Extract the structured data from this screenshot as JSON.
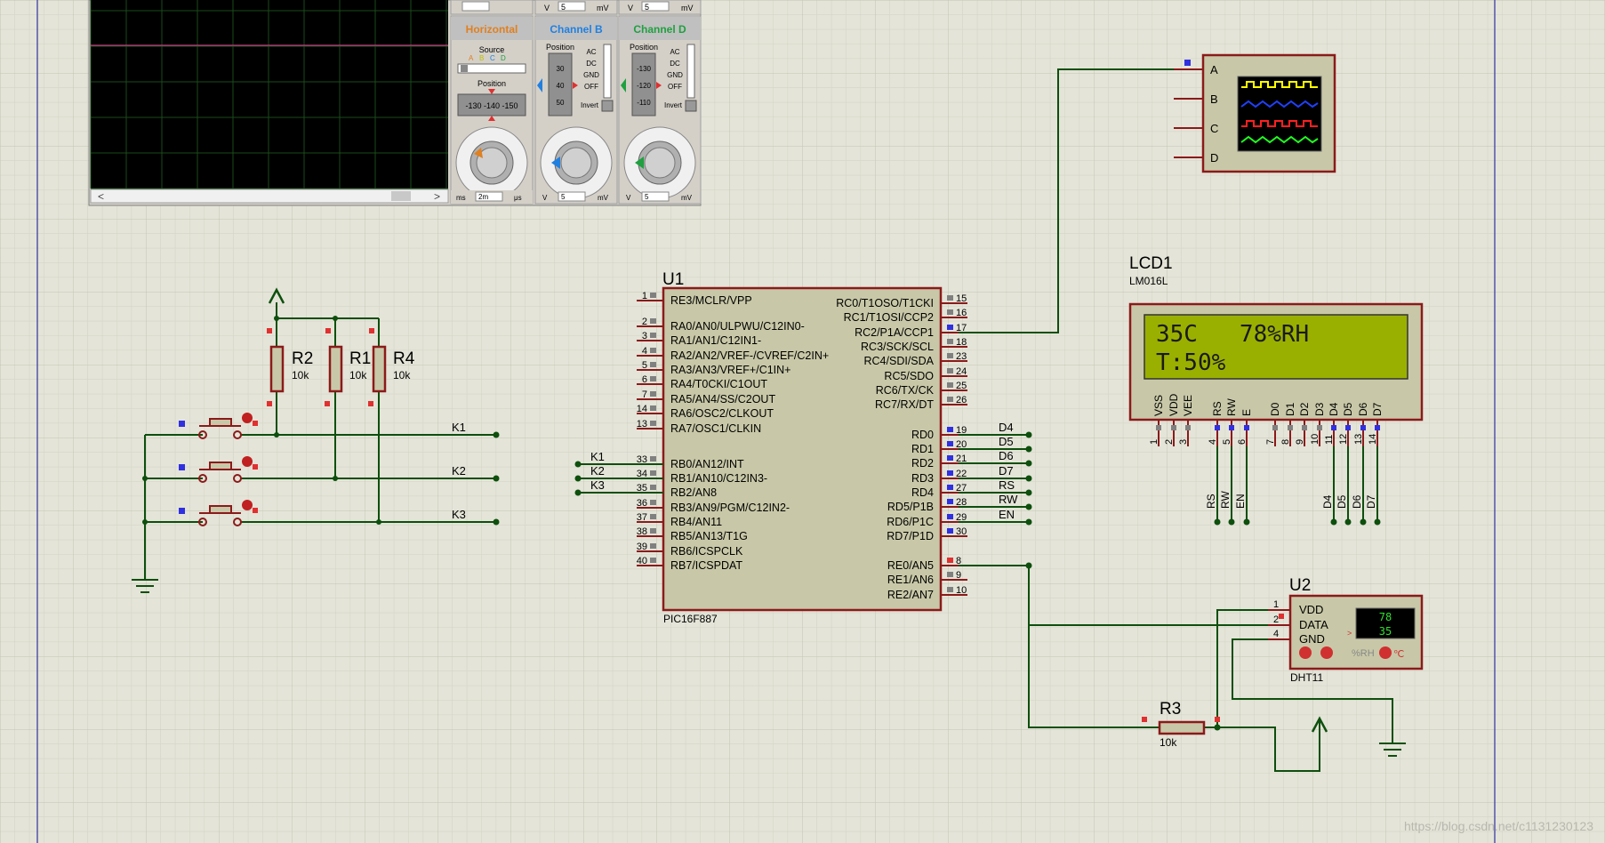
{
  "colors": {
    "background": "#e4e4d8",
    "grid_minor": "#d2d2c4",
    "grid_major": "#c4c4b4",
    "wire": "#0d4f0d",
    "component_outline": "#8b1a1a",
    "component_fill": "#c8c8a8",
    "pin_red": "#e03030",
    "pin_blue": "#3030e0",
    "lcd_screen": "#9ab000",
    "scope_screen": "#000000"
  },
  "mcu": {
    "ref": "U1",
    "part": "PIC16F887",
    "left_pins": [
      {
        "num": "1",
        "label": "RE3/MCLR/VPP"
      },
      {
        "num": "2",
        "label": "RA0/AN0/ULPWU/C12IN0-"
      },
      {
        "num": "3",
        "label": "RA1/AN1/C12IN1-"
      },
      {
        "num": "4",
        "label": "RA2/AN2/VREF-/CVREF/C2IN+"
      },
      {
        "num": "5",
        "label": "RA3/AN3/VREF+/C1IN+"
      },
      {
        "num": "6",
        "label": "RA4/T0CKI/C1OUT"
      },
      {
        "num": "7",
        "label": "RA5/AN4/SS/C2OUT"
      },
      {
        "num": "14",
        "label": "RA6/OSC2/CLKOUT"
      },
      {
        "num": "13",
        "label": "RA7/OSC1/CLKIN"
      },
      {
        "num": "33",
        "label": "RB0/AN12/INT"
      },
      {
        "num": "34",
        "label": "RB1/AN10/C12IN3-"
      },
      {
        "num": "35",
        "label": "RB2/AN8"
      },
      {
        "num": "36",
        "label": "RB3/AN9/PGM/C12IN2-"
      },
      {
        "num": "37",
        "label": "RB4/AN11"
      },
      {
        "num": "38",
        "label": "RB5/AN13/T1G"
      },
      {
        "num": "39",
        "label": "RB6/ICSPCLK"
      },
      {
        "num": "40",
        "label": "RB7/ICSPDAT"
      }
    ],
    "right_pins": [
      {
        "num": "15",
        "label": "RC0/T1OSO/T1CKI"
      },
      {
        "num": "16",
        "label": "RC1/T1OSI/CCP2"
      },
      {
        "num": "17",
        "label": "RC2/P1A/CCP1"
      },
      {
        "num": "18",
        "label": "RC3/SCK/SCL"
      },
      {
        "num": "23",
        "label": "RC4/SDI/SDA"
      },
      {
        "num": "24",
        "label": "RC5/SDO"
      },
      {
        "num": "25",
        "label": "RC6/TX/CK"
      },
      {
        "num": "26",
        "label": "RC7/RX/DT"
      },
      {
        "num": "19",
        "label": "RD0"
      },
      {
        "num": "20",
        "label": "RD1"
      },
      {
        "num": "21",
        "label": "RD2"
      },
      {
        "num": "22",
        "label": "RD3"
      },
      {
        "num": "27",
        "label": "RD4"
      },
      {
        "num": "28",
        "label": "RD5/P1B"
      },
      {
        "num": "29",
        "label": "RD6/P1C"
      },
      {
        "num": "30",
        "label": "RD7/P1D"
      },
      {
        "num": "8",
        "label": "RE0/AN5"
      },
      {
        "num": "9",
        "label": "RE1/AN6"
      },
      {
        "num": "10",
        "label": "RE2/AN7"
      }
    ],
    "net_labels_left": [
      "K1",
      "K2",
      "K3"
    ],
    "net_labels_right": [
      "D4",
      "D5",
      "D6",
      "D7",
      "RS",
      "RW",
      "EN"
    ]
  },
  "lcd": {
    "ref": "LCD1",
    "part": "LM016L",
    "line1": "35C   78%RH",
    "line2": "T:50%",
    "pin_names": [
      "VSS",
      "VDD",
      "VEE",
      "RS",
      "RW",
      "E",
      "D0",
      "D1",
      "D2",
      "D3",
      "D4",
      "D5",
      "D6",
      "D7"
    ],
    "pin_nums": [
      "1",
      "2",
      "3",
      "4",
      "5",
      "6",
      "7",
      "8",
      "9",
      "10",
      "11",
      "12",
      "13",
      "14"
    ],
    "net_labels": [
      "RS",
      "RW",
      "EN",
      "D4",
      "D5",
      "D6",
      "D7"
    ]
  },
  "sensor": {
    "ref": "U2",
    "part": "DHT11",
    "pins": [
      {
        "num": "1",
        "label": "VDD"
      },
      {
        "num": "2",
        "label": "DATA"
      },
      {
        "num": "4",
        "label": "GND"
      }
    ],
    "display_hum": "78",
    "display_temp": "35",
    "unit_label": "%RH",
    "symbol": "℃"
  },
  "scope": {
    "channels": [
      "A",
      "B",
      "C",
      "D"
    ],
    "panels": [
      {
        "title": "Horizontal",
        "color": "#e08020"
      },
      {
        "title": "Channel B",
        "color": "#2080e0"
      },
      {
        "title": "Channel D",
        "color": "#20a040"
      }
    ],
    "source_label": "Source",
    "position_label": "Position",
    "position_readout": "-130 -140 -150",
    "coupling": [
      "AC",
      "DC",
      "GND",
      "OFF"
    ],
    "invert_label": "Invert",
    "chb_scale": [
      "30",
      "40",
      "50"
    ],
    "chd_scale": [
      "-130",
      "-120",
      "-110"
    ],
    "top_units": [
      "V",
      "5",
      "mV",
      "V",
      "5",
      "mV"
    ],
    "bottom_horizontal": [
      "ms",
      "2m",
      "μs"
    ],
    "bottom_b": [
      "V",
      "5",
      "mV"
    ],
    "bottom_d": [
      "V",
      "5",
      "mV"
    ]
  },
  "resistors": [
    {
      "ref": "R2",
      "value": "10k"
    },
    {
      "ref": "R1",
      "value": "10k"
    },
    {
      "ref": "R4",
      "value": "10k"
    },
    {
      "ref": "R3",
      "value": "10k"
    }
  ],
  "switches": [
    {
      "net": "K1"
    },
    {
      "net": "K2"
    },
    {
      "net": "K3"
    }
  ],
  "watermark": "https://blog.csdn.net/c1131230123"
}
